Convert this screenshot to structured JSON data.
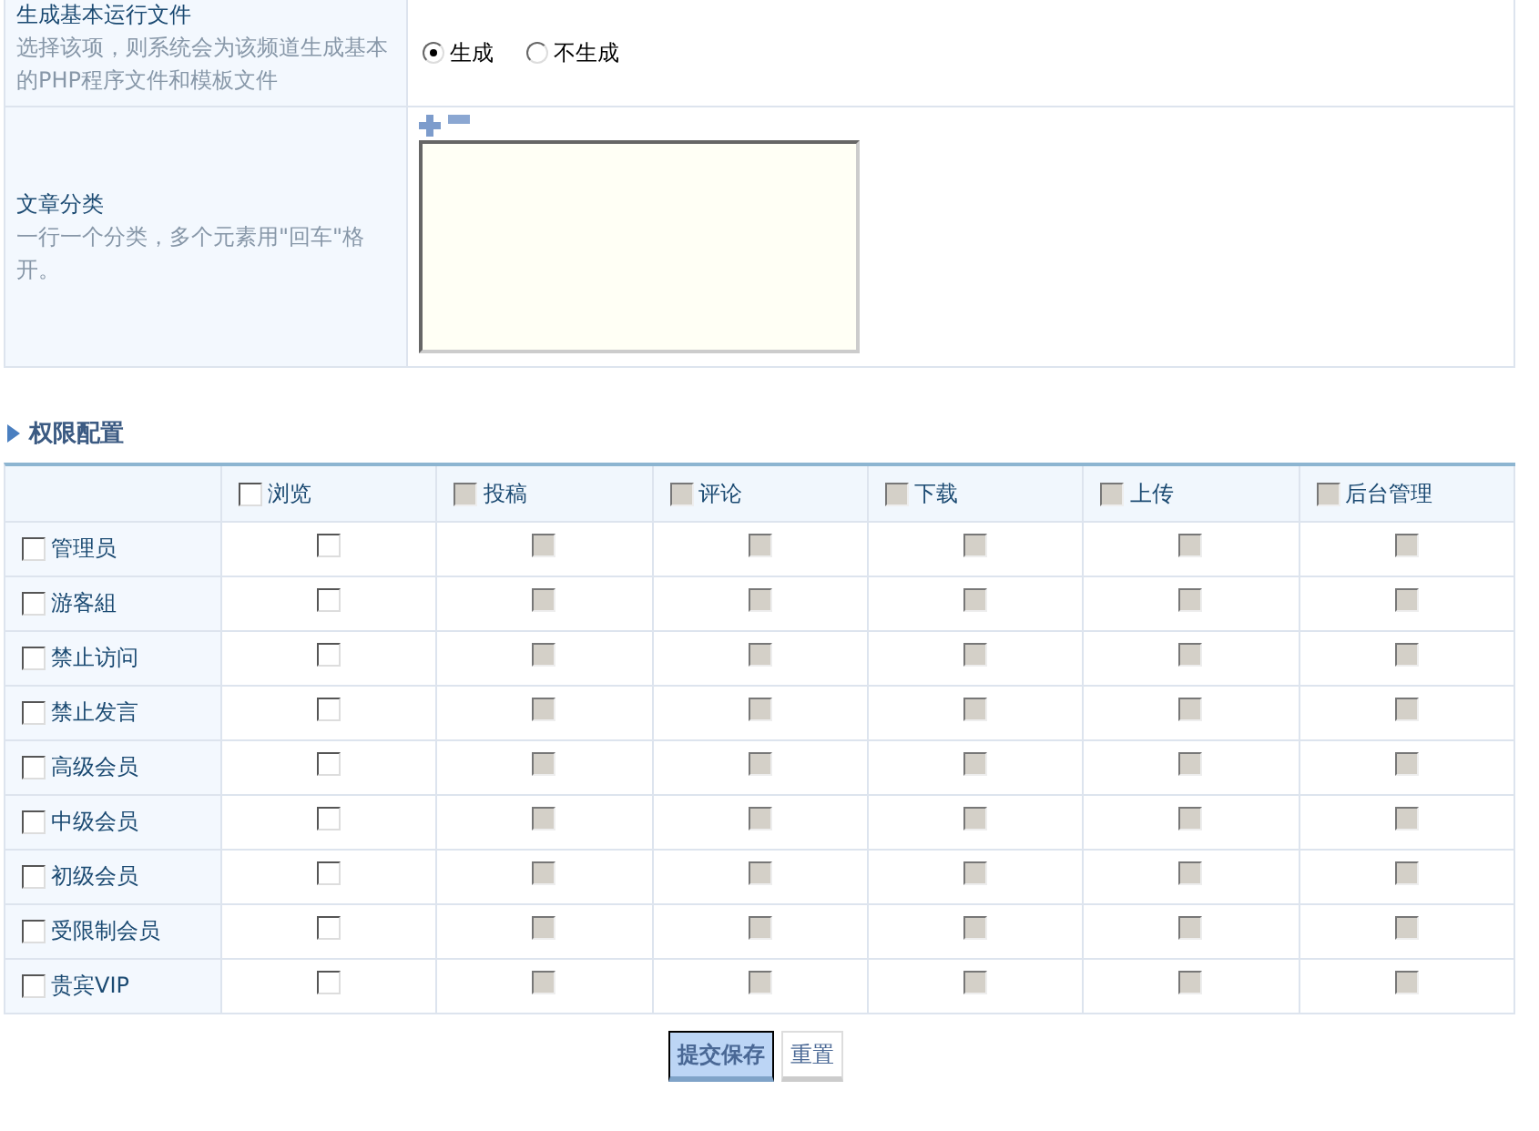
{
  "form_rows": [
    {
      "kind": "radio",
      "label": "生成基本运行文件",
      "description": "选择该项，则系统会为该频道生成基本的PHP程序文件和模板文件",
      "options": [
        {
          "label": "生成",
          "selected": true
        },
        {
          "label": "不生成",
          "selected": false
        }
      ]
    },
    {
      "kind": "textarea",
      "label": "文章分类",
      "description": "一行一个分类，多个元素用\"回车\"格开。"
    }
  ],
  "permissions": {
    "title": "权限配置",
    "columns": [
      {
        "label": "浏览",
        "checked": false,
        "disabled": false
      },
      {
        "label": "投稿",
        "checked": false,
        "disabled": true
      },
      {
        "label": "评论",
        "checked": false,
        "disabled": true
      },
      {
        "label": "下载",
        "checked": false,
        "disabled": true
      },
      {
        "label": "上传",
        "checked": false,
        "disabled": true
      },
      {
        "label": "后台管理",
        "checked": false,
        "disabled": true
      }
    ],
    "rows": [
      {
        "label": "管理员",
        "checked": false,
        "cells": [
          {
            "checked": false,
            "disabled": false
          },
          {
            "checked": false,
            "disabled": true
          },
          {
            "checked": false,
            "disabled": true
          },
          {
            "checked": false,
            "disabled": true
          },
          {
            "checked": false,
            "disabled": true
          },
          {
            "checked": false,
            "disabled": true
          }
        ]
      },
      {
        "label": "游客組",
        "checked": false,
        "cells": [
          {
            "checked": false,
            "disabled": false
          },
          {
            "checked": false,
            "disabled": true
          },
          {
            "checked": false,
            "disabled": true
          },
          {
            "checked": false,
            "disabled": true
          },
          {
            "checked": false,
            "disabled": true
          },
          {
            "checked": false,
            "disabled": true
          }
        ]
      },
      {
        "label": "禁止访问",
        "checked": false,
        "cells": [
          {
            "checked": false,
            "disabled": false
          },
          {
            "checked": false,
            "disabled": true
          },
          {
            "checked": false,
            "disabled": true
          },
          {
            "checked": false,
            "disabled": true
          },
          {
            "checked": false,
            "disabled": true
          },
          {
            "checked": false,
            "disabled": true
          }
        ]
      },
      {
        "label": "禁止发言",
        "checked": false,
        "cells": [
          {
            "checked": false,
            "disabled": false
          },
          {
            "checked": false,
            "disabled": true
          },
          {
            "checked": false,
            "disabled": true
          },
          {
            "checked": false,
            "disabled": true
          },
          {
            "checked": false,
            "disabled": true
          },
          {
            "checked": false,
            "disabled": true
          }
        ]
      },
      {
        "label": "高级会员",
        "checked": false,
        "cells": [
          {
            "checked": false,
            "disabled": false
          },
          {
            "checked": false,
            "disabled": true
          },
          {
            "checked": false,
            "disabled": true
          },
          {
            "checked": false,
            "disabled": true
          },
          {
            "checked": false,
            "disabled": true
          },
          {
            "checked": false,
            "disabled": true
          }
        ]
      },
      {
        "label": "中级会员",
        "checked": false,
        "cells": [
          {
            "checked": false,
            "disabled": false
          },
          {
            "checked": false,
            "disabled": true
          },
          {
            "checked": false,
            "disabled": true
          },
          {
            "checked": false,
            "disabled": true
          },
          {
            "checked": false,
            "disabled": true
          },
          {
            "checked": false,
            "disabled": true
          }
        ]
      },
      {
        "label": "初级会员",
        "checked": false,
        "cells": [
          {
            "checked": false,
            "disabled": false
          },
          {
            "checked": false,
            "disabled": true
          },
          {
            "checked": false,
            "disabled": true
          },
          {
            "checked": false,
            "disabled": true
          },
          {
            "checked": false,
            "disabled": true
          },
          {
            "checked": false,
            "disabled": true
          }
        ]
      },
      {
        "label": "受限制会员",
        "checked": false,
        "cells": [
          {
            "checked": false,
            "disabled": false
          },
          {
            "checked": false,
            "disabled": true
          },
          {
            "checked": false,
            "disabled": true
          },
          {
            "checked": false,
            "disabled": true
          },
          {
            "checked": false,
            "disabled": true
          },
          {
            "checked": false,
            "disabled": true
          }
        ]
      },
      {
        "label": "贵宾VIP",
        "checked": false,
        "cells": [
          {
            "checked": false,
            "disabled": false
          },
          {
            "checked": false,
            "disabled": true
          },
          {
            "checked": false,
            "disabled": true
          },
          {
            "checked": false,
            "disabled": true
          },
          {
            "checked": false,
            "disabled": true
          },
          {
            "checked": false,
            "disabled": true
          }
        ]
      }
    ]
  },
  "buttons": [
    {
      "label": "提交保存",
      "kind": "primary"
    },
    {
      "label": "重置",
      "kind": "secondary"
    }
  ]
}
